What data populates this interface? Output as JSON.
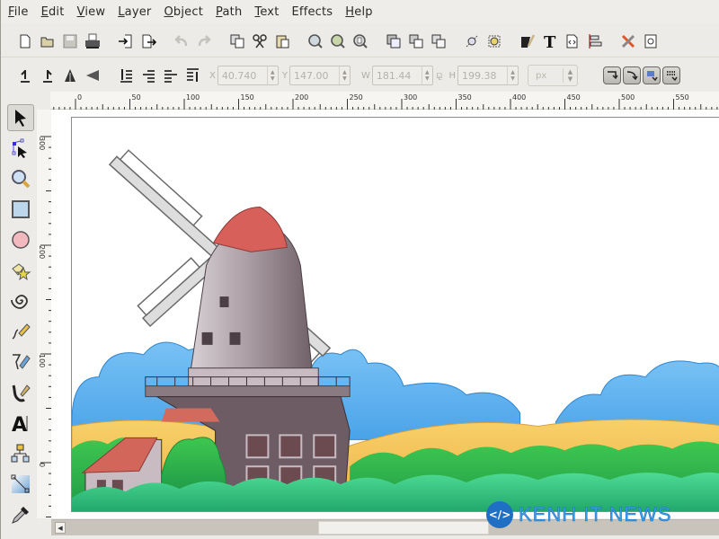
{
  "menu": {
    "items": [
      {
        "label": "File",
        "accel": "F",
        "rest": "ile"
      },
      {
        "label": "Edit",
        "accel": "E",
        "rest": "dit"
      },
      {
        "label": "View",
        "accel": "V",
        "rest": "iew"
      },
      {
        "label": "Layer",
        "accel": "L",
        "rest": "ayer"
      },
      {
        "label": "Object",
        "accel": "O",
        "rest": "bject"
      },
      {
        "label": "Path",
        "accel": "P",
        "rest": "ath"
      },
      {
        "label": "Text",
        "accel": "T",
        "rest": "ext"
      },
      {
        "label": "Effects",
        "accel": "",
        "rest": "Effects"
      },
      {
        "label": "Help",
        "accel": "H",
        "rest": "elp"
      }
    ]
  },
  "commands_toolbar": {
    "buttons": [
      "new-document-icon",
      "open-folder-icon",
      "save-icon",
      "print-icon",
      "import-icon",
      "export-icon",
      "undo-icon",
      "redo-icon",
      "duplicate-icon",
      "cut-icon",
      "paste-icon",
      "zoom-selection-icon",
      "zoom-drawing-icon",
      "zoom-page-icon",
      "group-icon",
      "ungroup-icon",
      "clone-icon",
      "node-edit-icon",
      "transform-icon",
      "fill-stroke-icon",
      "text-font-icon",
      "xml-editor-icon",
      "align-distribute-icon",
      "preferences-icon",
      "document-properties-icon"
    ]
  },
  "controls_toolbar": {
    "x_label": "X",
    "x_value": "40.740",
    "y_label": "Y",
    "y_value": "147.00",
    "w_label": "W",
    "w_value": "181.44",
    "h_label": "H",
    "h_value": "199.38",
    "unit": "px",
    "lock_icon": "lock-icon"
  },
  "rulers": {
    "horizontal": [
      "0",
      "50",
      "100",
      "150",
      "200",
      "250",
      "300",
      "350",
      "400",
      "450",
      "500",
      "550"
    ],
    "vertical": [
      "300",
      "200",
      "100",
      "0"
    ]
  },
  "toolbox": {
    "tools": [
      {
        "name": "selector-tool",
        "active": true
      },
      {
        "name": "node-tool",
        "active": false
      },
      {
        "name": "zoom-tool",
        "active": false
      },
      {
        "name": "rectangle-tool",
        "active": false
      },
      {
        "name": "ellipse-tool",
        "active": false
      },
      {
        "name": "star-tool",
        "active": false
      },
      {
        "name": "spiral-tool",
        "active": false
      },
      {
        "name": "pencil-tool",
        "active": false
      },
      {
        "name": "pen-tool",
        "active": false
      },
      {
        "name": "calligraphy-tool",
        "active": false
      },
      {
        "name": "text-tool",
        "active": false
      },
      {
        "name": "connector-tool",
        "active": false
      },
      {
        "name": "gradient-tool",
        "active": false
      },
      {
        "name": "dropper-tool",
        "active": false
      }
    ]
  },
  "canvas": {
    "artwork": "windmill-landscape-illustration",
    "colors": {
      "sky_cloud": "#5aaef0",
      "hill_yellow": "#f2c45a",
      "bush_green": "#2fb34a",
      "bush_light": "#3ed08a",
      "windmill_body": "#7a6a72",
      "roof_red": "#d85a52"
    }
  },
  "watermark": {
    "badge": "</>",
    "text": "KENH IT NEWS"
  }
}
